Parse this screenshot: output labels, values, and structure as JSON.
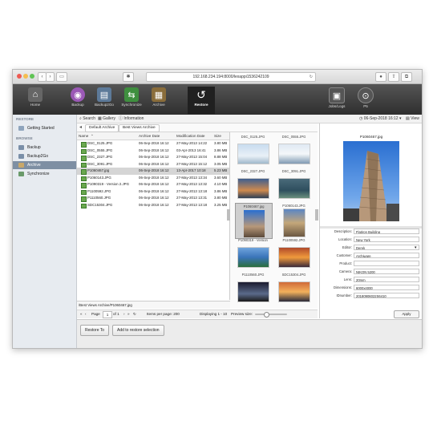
{
  "browser": {
    "url": "192.168.234.194:8000/lexappi1536242109"
  },
  "toolbar": {
    "items": [
      {
        "label": "Home",
        "icon": "home-icon"
      },
      {
        "label": "Backup",
        "icon": "backup-icon"
      },
      {
        "label": "Backup2Go",
        "icon": "backup2go-icon"
      },
      {
        "label": "Synchronize",
        "icon": "synchronize-icon"
      },
      {
        "label": "Archive",
        "icon": "archive-icon"
      },
      {
        "label": "Restore",
        "icon": "restore-icon"
      },
      {
        "label": "Jobs/Logs",
        "icon": "jobs-logs-icon"
      },
      {
        "label": "P5",
        "icon": "p5-icon"
      }
    ]
  },
  "sidebar": {
    "restore_header": "RESTORE",
    "getting_started": "Getting Started",
    "browse_header": "BROWSE",
    "items": [
      {
        "label": "Backup"
      },
      {
        "label": "Backup2Go"
      },
      {
        "label": "Archive"
      },
      {
        "label": "Synchronize"
      }
    ]
  },
  "subtoolbar": {
    "search": "Search",
    "gallery": "Gallery",
    "information": "Information",
    "date": "06-Sep-2018 16:12",
    "view": "View"
  },
  "breadcrumb": {
    "items": [
      "Default Archive",
      "Best Views Archive"
    ]
  },
  "files": {
    "columns": [
      "Name",
      "Archive Date",
      "Modification Date",
      "Size"
    ],
    "rows": [
      [
        "DSC_0125.JPG",
        "06-Sep-2018 16:12",
        "27-May-2013 14:22",
        "3.80 MB"
      ],
      [
        "DSC_0555.JPG",
        "06-Sep-2018 16:12",
        "03-Apr-2013 16:41",
        "3.86 MB"
      ],
      [
        "DSC_2327.JPG",
        "06-Sep-2018 16:12",
        "27-May-2013 15:04",
        "8.88 MB"
      ],
      [
        "DSC_3091.JPG",
        "06-Sep-2018 16:12",
        "27-May-2013 15:12",
        "3.05 MB"
      ],
      [
        "P1060467.jpg",
        "06-Sep-2018 16:12",
        "13-Apr-2017 10:18",
        "5.23 MB"
      ],
      [
        "P1060143.JPG",
        "06-Sep-2018 16:12",
        "27-May-2013 13:34",
        "3.60 MB"
      ],
      [
        "P1090319 - Version 2.JPG",
        "06-Sep-2018 16:12",
        "27-May-2013 13:32",
        "4.10 MB"
      ],
      [
        "P1100592.JPG",
        "06-Sep-2018 16:12",
        "27-May-2013 13:18",
        "3.86 MB"
      ],
      [
        "P1110560.JPG",
        "06-Sep-2018 16:12",
        "27-May-2013 13:31",
        "3.80 MB"
      ],
      [
        "SDC15304.JPG",
        "06-Sep-2018 16:12",
        "27-May-2013 13:18",
        "3.25 MB"
      ]
    ],
    "selected_index": 4,
    "path": "/Best Views Archive/P1060467.jpg"
  },
  "pager": {
    "page_label": "Page",
    "page": "1",
    "of": "of 1",
    "items_per_page": "Items per page: 200",
    "displaying": "Displaying 1 - 10",
    "preview_size": "Preview size:"
  },
  "thumbnails": [
    {
      "caption": "DSC_0125.JPG"
    },
    {
      "caption": "DSC_0555.JPG"
    },
    {
      "caption": "DSC_2327.JPG"
    },
    {
      "caption": "DSC_3091.JPG"
    },
    {
      "caption": "P1060467.jpg"
    },
    {
      "caption": "P1060143.JPG"
    },
    {
      "caption": "P1090319 - Version"
    },
    {
      "caption": "P1100592.JPG"
    },
    {
      "caption": "P1110560.JPG"
    },
    {
      "caption": "SDC15304.JPG"
    }
  ],
  "preview": {
    "title": "P1060467.jpg"
  },
  "metadata": [
    {
      "label": "Description:",
      "value": "Flatiron Building"
    },
    {
      "label": "Location:",
      "value": "New York"
    },
    {
      "label": "Editor:",
      "value": "Derek"
    },
    {
      "label": "Customer:",
      "value": "Archiware"
    },
    {
      "label": "Product:",
      "value": ""
    },
    {
      "label": "Camera:",
      "value": "NIKON 5200"
    },
    {
      "label": "Lens:",
      "value": "20mm"
    },
    {
      "label": "Dimensions:",
      "value": "6000x4000"
    },
    {
      "label": "IDnumber:",
      "value": "20180906022S6410"
    }
  ],
  "buttons": {
    "apply": "Apply",
    "restore_to": "Restore To",
    "add_to_restore": "Add to restore selection"
  },
  "colors": {
    "toolbar_bg": "#3a3a3a",
    "sidebar_selected": "#7e8fa3",
    "row_selected": "#d5d5d5"
  }
}
